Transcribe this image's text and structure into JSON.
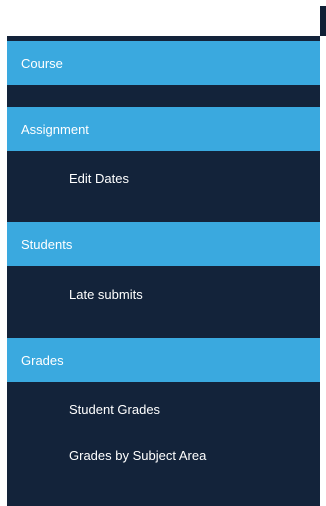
{
  "sidebar": {
    "sections": [
      {
        "label": "Course",
        "items": []
      },
      {
        "label": "Assignment",
        "items": [
          "Edit Dates"
        ]
      },
      {
        "label": "Students",
        "items": [
          "Late submits"
        ]
      },
      {
        "label": "Grades",
        "items": [
          "Student Grades",
          "Grades by Subject Area"
        ]
      }
    ]
  },
  "colors": {
    "sidebar_bg": "#13233a",
    "header_bg": "#3aa9df",
    "text": "#ffffff"
  }
}
